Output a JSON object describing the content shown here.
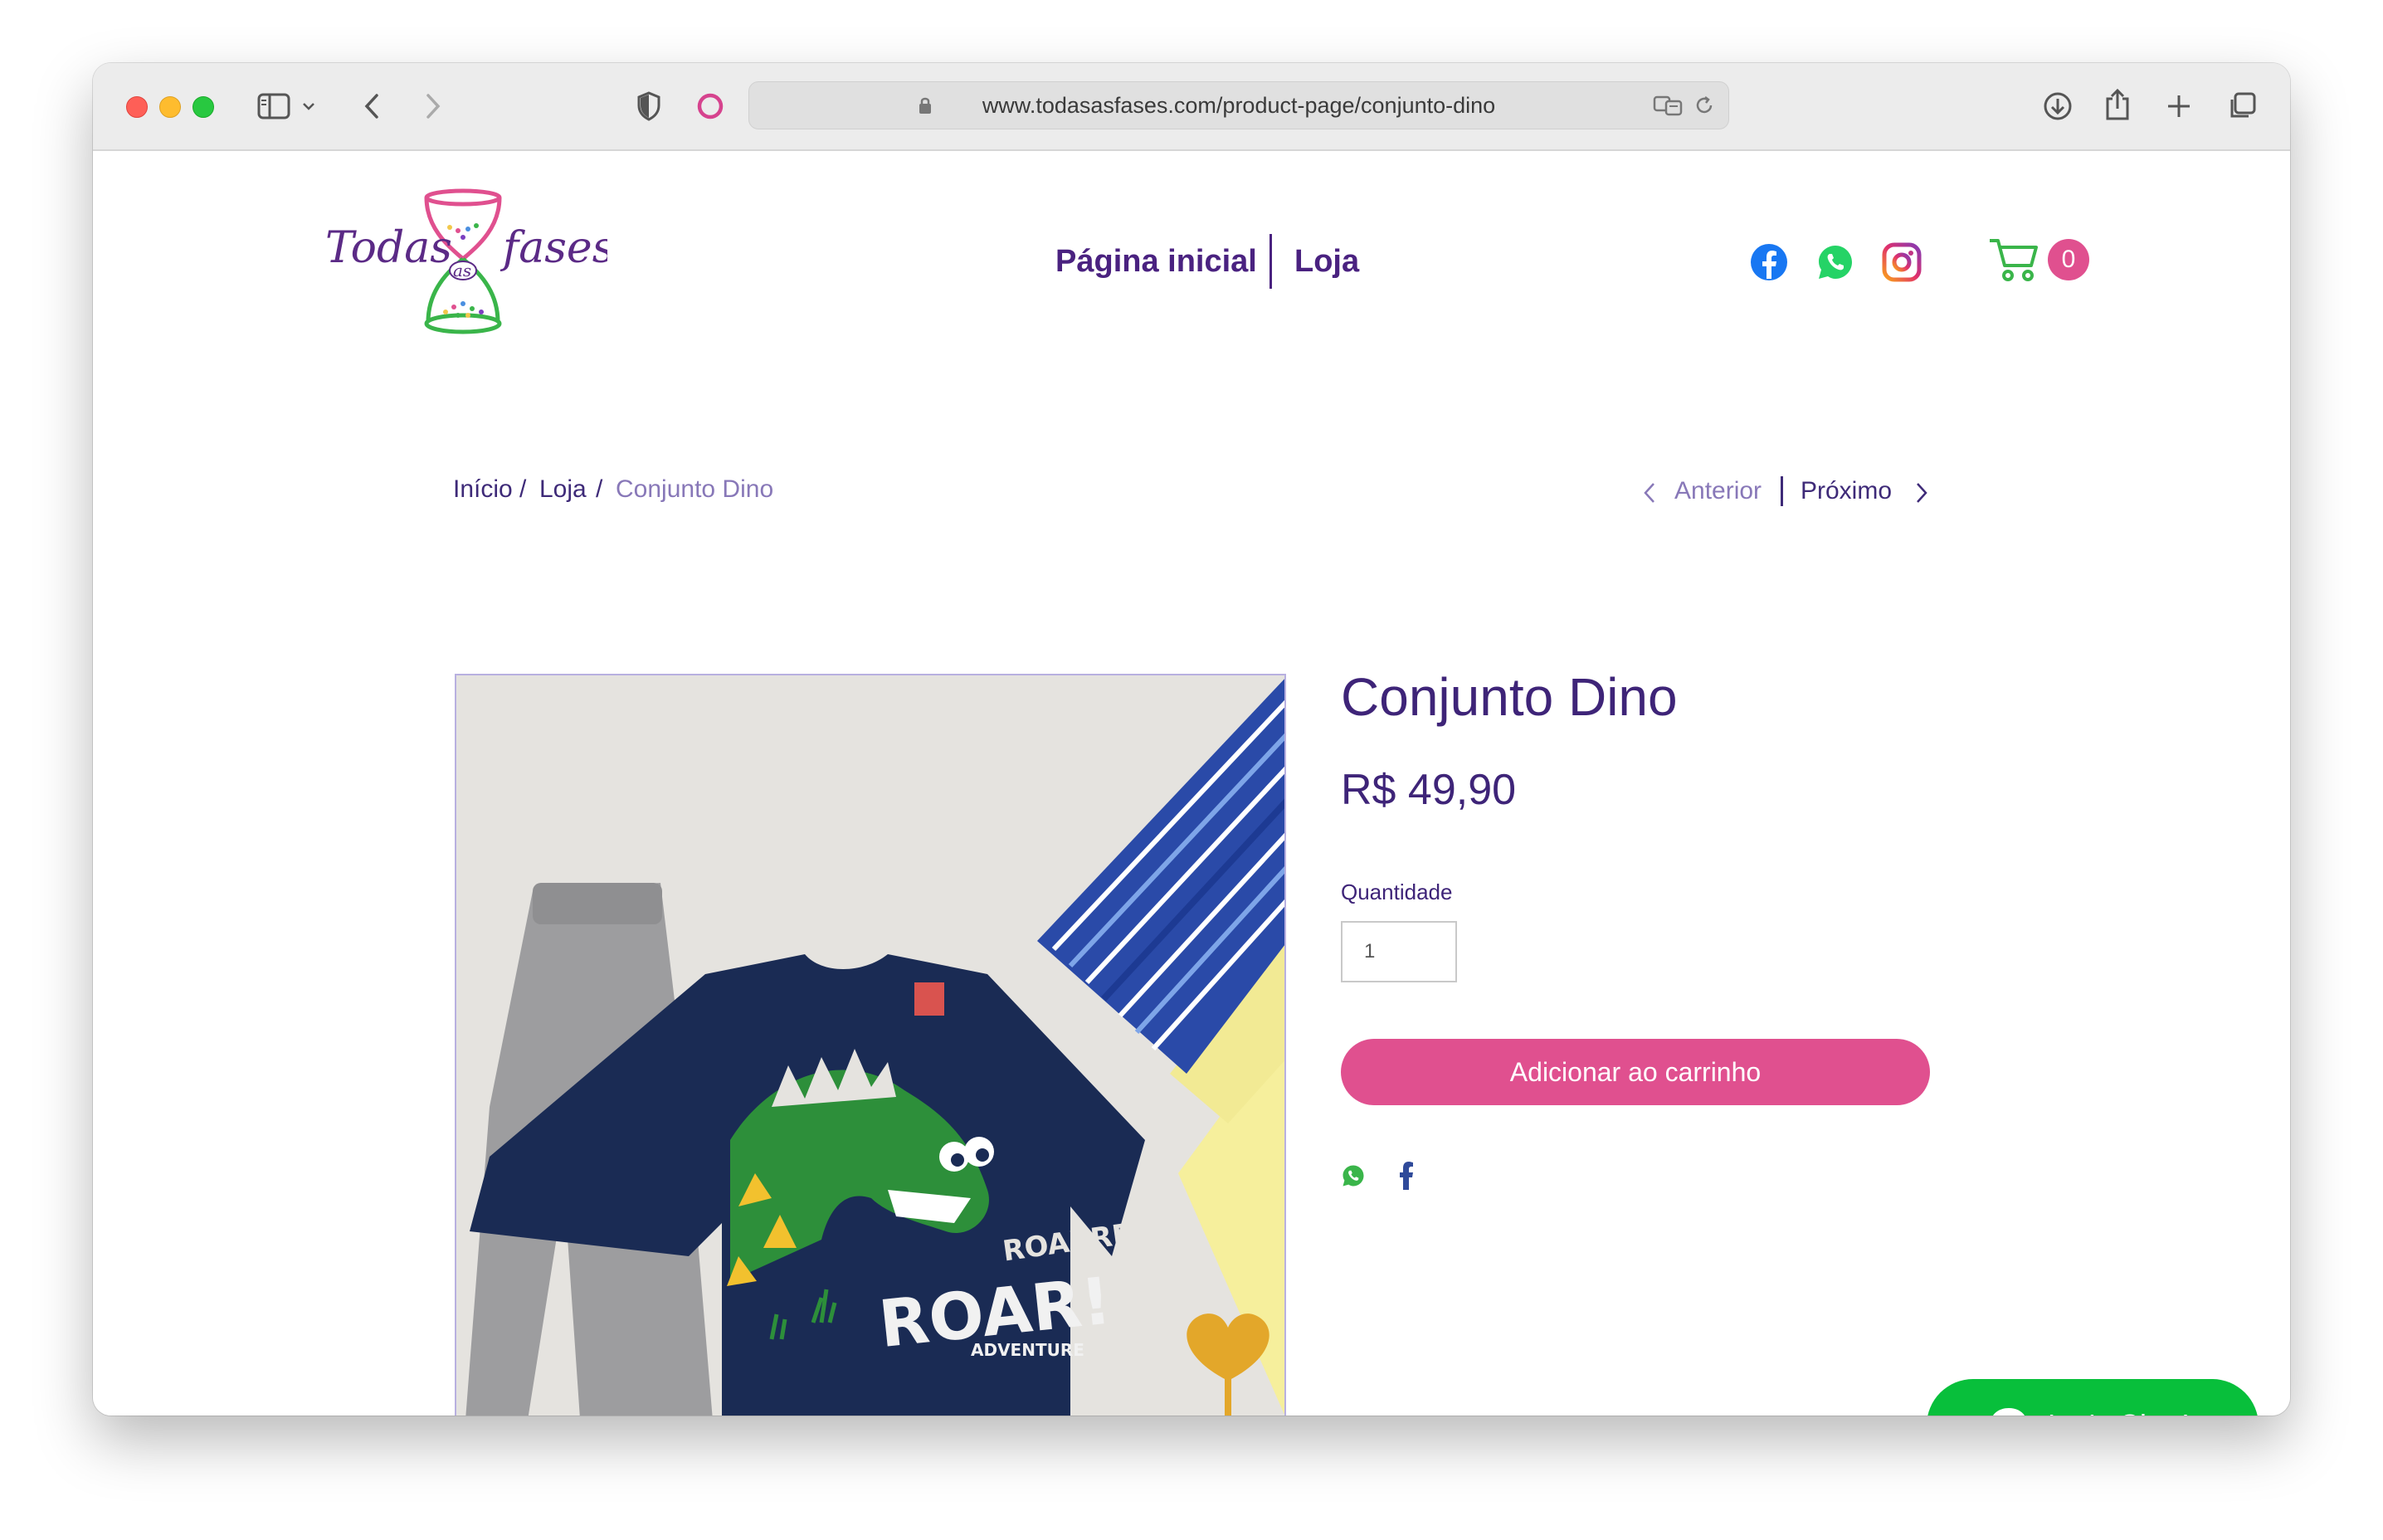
{
  "browser": {
    "url": "www.todasasfases.com/product-page/conjunto-dino"
  },
  "site": {
    "logo_text": "Todas as fases",
    "nav": {
      "home": "Página inicial",
      "shop": "Loja"
    },
    "social_icons": [
      "facebook-icon",
      "whatsapp-icon",
      "instagram-icon"
    ],
    "cart_count": "0"
  },
  "breadcrumb": {
    "home": "Início",
    "sep1": "/",
    "shop": "Loja",
    "sep2": "/",
    "current": "Conjunto Dino"
  },
  "pager": {
    "prev": "Anterior",
    "next": "Próximo"
  },
  "product": {
    "title": "Conjunto Dino",
    "price": "R$ 49,90",
    "quantity_label": "Quantidade",
    "quantity_value": "1",
    "add_to_cart": "Adicionar ao carrinho",
    "image_text": {
      "roarrr": "ROARRR",
      "roar": "ROAR!",
      "adventure": "ADVENTURE"
    }
  },
  "chat": {
    "label": "Let's Chat!"
  },
  "colors": {
    "brand_purple": "#4a2280",
    "brand_pink": "#e0508f",
    "brand_green": "#3ab54a",
    "chat_green": "#08bf3b"
  }
}
